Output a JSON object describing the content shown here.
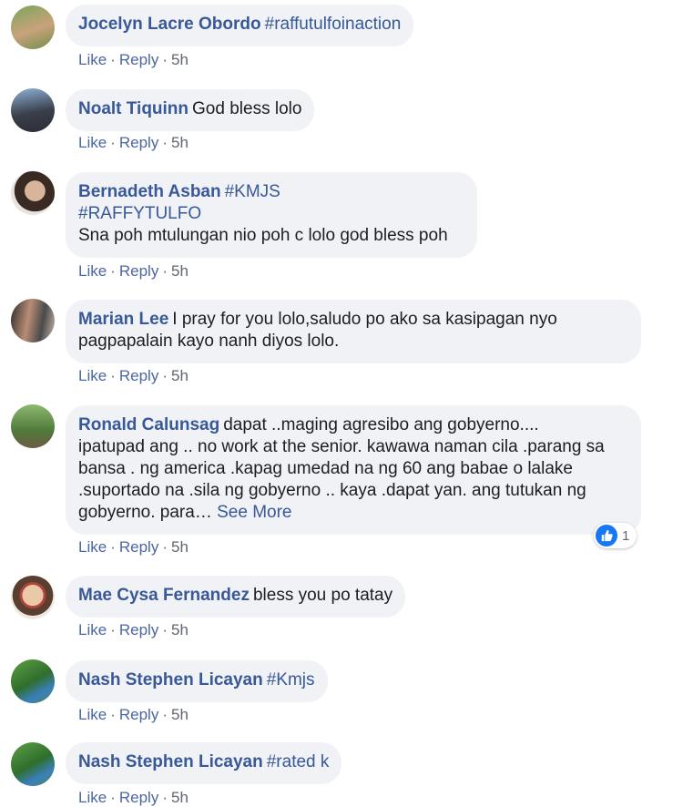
{
  "comments": [
    {
      "name": "Jocelyn Lacre Obordo",
      "text": "#raffutulfoinaction",
      "like": "Like",
      "reply": "Reply",
      "time": "5h"
    },
    {
      "name": "Noalt Tiquinn",
      "text": "God bless lolo",
      "like": "Like",
      "reply": "Reply",
      "time": "5h"
    },
    {
      "name": "Bernadeth Asban",
      "hashtag1": "#KMJS",
      "hashtag2": "#RAFFYTULFO",
      "text": "Sna poh mtulungan nio poh c lolo god bless poh",
      "like": "Like",
      "reply": "Reply",
      "time": "5h"
    },
    {
      "name": "Marian Lee",
      "text_line1": "I pray for you lolo,saludo po ako sa kasipagan nyo",
      "text_line2": "pagpapalain kayo nanh diyos lolo.",
      "like": "Like",
      "reply": "Reply",
      "time": "5h"
    },
    {
      "name": "Ronald Calunsag",
      "text_line1": "dapat ..maging agresibo ang gobyerno....",
      "text_line2": "ipatupad ang .. no work at the senior. kawawa naman cila .parang sa",
      "text_line3": "bansa . ng america .kapag umedad na ng 60 ang babae o lalake",
      "text_line4": ".suportado na .sila ng gobyerno .. kaya .dapat yan. ang tutukan ng",
      "text_line5": "gobyerno. para…",
      "see_more": "See More",
      "reaction_count": "1",
      "like": "Like",
      "reply": "Reply",
      "time": "5h"
    },
    {
      "name": "Mae Cysa Fernandez",
      "text": "bless you po tatay",
      "like": "Like",
      "reply": "Reply",
      "time": "5h"
    },
    {
      "name": "Nash Stephen Licayan",
      "text": "#Kmjs",
      "like": "Like",
      "reply": "Reply",
      "time": "5h"
    },
    {
      "name": "Nash Stephen Licayan",
      "text": "#rated k",
      "like": "Like",
      "reply": "Reply",
      "time": "5h"
    }
  ],
  "colors": {
    "link": "#385898",
    "bubble": "#f0f2f5",
    "like_blue": "#1877f2"
  }
}
